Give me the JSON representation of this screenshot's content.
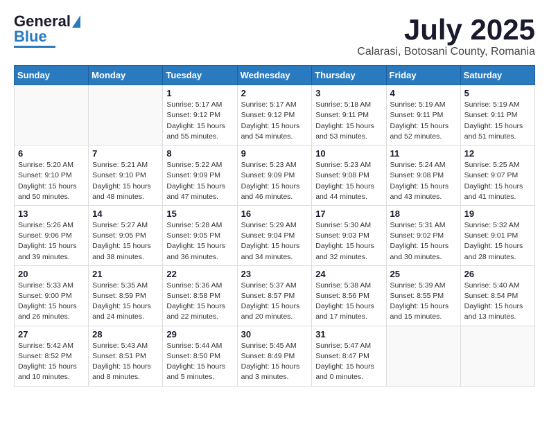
{
  "header": {
    "logo_line1": "General",
    "logo_line2": "Blue",
    "month_title": "July 2025",
    "subtitle": "Calarasi, Botosani County, Romania"
  },
  "days_of_week": [
    "Sunday",
    "Monday",
    "Tuesday",
    "Wednesday",
    "Thursday",
    "Friday",
    "Saturday"
  ],
  "weeks": [
    [
      {
        "day": "",
        "info": ""
      },
      {
        "day": "",
        "info": ""
      },
      {
        "day": "1",
        "info": "Sunrise: 5:17 AM\nSunset: 9:12 PM\nDaylight: 15 hours\nand 55 minutes."
      },
      {
        "day": "2",
        "info": "Sunrise: 5:17 AM\nSunset: 9:12 PM\nDaylight: 15 hours\nand 54 minutes."
      },
      {
        "day": "3",
        "info": "Sunrise: 5:18 AM\nSunset: 9:11 PM\nDaylight: 15 hours\nand 53 minutes."
      },
      {
        "day": "4",
        "info": "Sunrise: 5:19 AM\nSunset: 9:11 PM\nDaylight: 15 hours\nand 52 minutes."
      },
      {
        "day": "5",
        "info": "Sunrise: 5:19 AM\nSunset: 9:11 PM\nDaylight: 15 hours\nand 51 minutes."
      }
    ],
    [
      {
        "day": "6",
        "info": "Sunrise: 5:20 AM\nSunset: 9:10 PM\nDaylight: 15 hours\nand 50 minutes."
      },
      {
        "day": "7",
        "info": "Sunrise: 5:21 AM\nSunset: 9:10 PM\nDaylight: 15 hours\nand 48 minutes."
      },
      {
        "day": "8",
        "info": "Sunrise: 5:22 AM\nSunset: 9:09 PM\nDaylight: 15 hours\nand 47 minutes."
      },
      {
        "day": "9",
        "info": "Sunrise: 5:23 AM\nSunset: 9:09 PM\nDaylight: 15 hours\nand 46 minutes."
      },
      {
        "day": "10",
        "info": "Sunrise: 5:23 AM\nSunset: 9:08 PM\nDaylight: 15 hours\nand 44 minutes."
      },
      {
        "day": "11",
        "info": "Sunrise: 5:24 AM\nSunset: 9:08 PM\nDaylight: 15 hours\nand 43 minutes."
      },
      {
        "day": "12",
        "info": "Sunrise: 5:25 AM\nSunset: 9:07 PM\nDaylight: 15 hours\nand 41 minutes."
      }
    ],
    [
      {
        "day": "13",
        "info": "Sunrise: 5:26 AM\nSunset: 9:06 PM\nDaylight: 15 hours\nand 39 minutes."
      },
      {
        "day": "14",
        "info": "Sunrise: 5:27 AM\nSunset: 9:05 PM\nDaylight: 15 hours\nand 38 minutes."
      },
      {
        "day": "15",
        "info": "Sunrise: 5:28 AM\nSunset: 9:05 PM\nDaylight: 15 hours\nand 36 minutes."
      },
      {
        "day": "16",
        "info": "Sunrise: 5:29 AM\nSunset: 9:04 PM\nDaylight: 15 hours\nand 34 minutes."
      },
      {
        "day": "17",
        "info": "Sunrise: 5:30 AM\nSunset: 9:03 PM\nDaylight: 15 hours\nand 32 minutes."
      },
      {
        "day": "18",
        "info": "Sunrise: 5:31 AM\nSunset: 9:02 PM\nDaylight: 15 hours\nand 30 minutes."
      },
      {
        "day": "19",
        "info": "Sunrise: 5:32 AM\nSunset: 9:01 PM\nDaylight: 15 hours\nand 28 minutes."
      }
    ],
    [
      {
        "day": "20",
        "info": "Sunrise: 5:33 AM\nSunset: 9:00 PM\nDaylight: 15 hours\nand 26 minutes."
      },
      {
        "day": "21",
        "info": "Sunrise: 5:35 AM\nSunset: 8:59 PM\nDaylight: 15 hours\nand 24 minutes."
      },
      {
        "day": "22",
        "info": "Sunrise: 5:36 AM\nSunset: 8:58 PM\nDaylight: 15 hours\nand 22 minutes."
      },
      {
        "day": "23",
        "info": "Sunrise: 5:37 AM\nSunset: 8:57 PM\nDaylight: 15 hours\nand 20 minutes."
      },
      {
        "day": "24",
        "info": "Sunrise: 5:38 AM\nSunset: 8:56 PM\nDaylight: 15 hours\nand 17 minutes."
      },
      {
        "day": "25",
        "info": "Sunrise: 5:39 AM\nSunset: 8:55 PM\nDaylight: 15 hours\nand 15 minutes."
      },
      {
        "day": "26",
        "info": "Sunrise: 5:40 AM\nSunset: 8:54 PM\nDaylight: 15 hours\nand 13 minutes."
      }
    ],
    [
      {
        "day": "27",
        "info": "Sunrise: 5:42 AM\nSunset: 8:52 PM\nDaylight: 15 hours\nand 10 minutes."
      },
      {
        "day": "28",
        "info": "Sunrise: 5:43 AM\nSunset: 8:51 PM\nDaylight: 15 hours\nand 8 minutes."
      },
      {
        "day": "29",
        "info": "Sunrise: 5:44 AM\nSunset: 8:50 PM\nDaylight: 15 hours\nand 5 minutes."
      },
      {
        "day": "30",
        "info": "Sunrise: 5:45 AM\nSunset: 8:49 PM\nDaylight: 15 hours\nand 3 minutes."
      },
      {
        "day": "31",
        "info": "Sunrise: 5:47 AM\nSunset: 8:47 PM\nDaylight: 15 hours\nand 0 minutes."
      },
      {
        "day": "",
        "info": ""
      },
      {
        "day": "",
        "info": ""
      }
    ]
  ]
}
